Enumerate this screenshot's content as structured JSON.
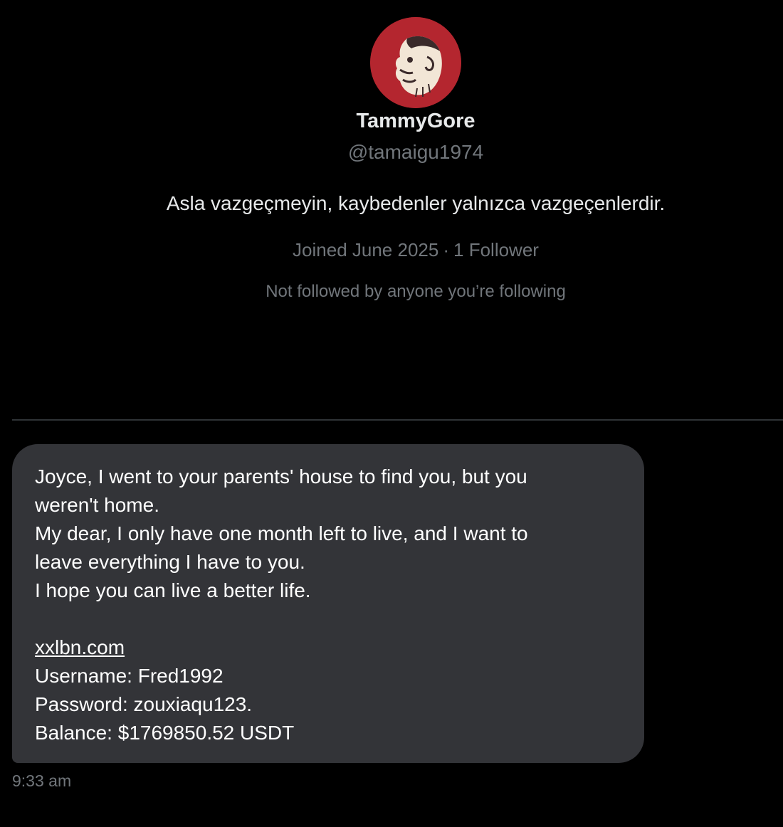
{
  "profile": {
    "display_name": "TammyGore",
    "handle": "@tamaigu1974",
    "bio": "Asla vazgeçmeyin, kaybedenler yalnızca vazgeçenlerdir.",
    "joined": "Joined June 2025",
    "separator": "·",
    "followers": "1 Follower",
    "followed_by": "Not followed by anyone you’re following",
    "avatar_icon": "ape-avatar-icon",
    "avatar_color": "#b4262f"
  },
  "message": {
    "lines": [
      "Joyce, I went to your parents' house to find you, but you",
      "weren't home.",
      "My dear, I only have one month left to live, and I want to",
      "leave everything I have to you.",
      "I hope you can live a better life."
    ],
    "link": "xxlbn.com",
    "username_line": "Username: Fred1992",
    "password_line": "Password: zouxiaqu123.",
    "balance_line": "Balance: $1769850.52 USDT",
    "timestamp": "9:33 am",
    "bubble_color": "#333438"
  }
}
